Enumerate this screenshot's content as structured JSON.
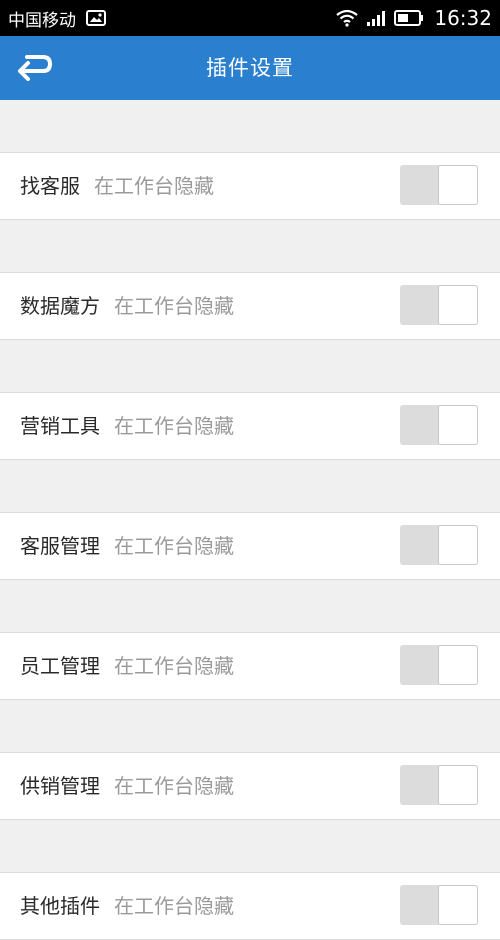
{
  "status_bar": {
    "carrier": "中国移动",
    "time": "16:32",
    "icons": [
      "picture-icon",
      "wifi-icon",
      "signal-icon",
      "battery-icon"
    ]
  },
  "header": {
    "title": "插件设置",
    "back_icon": "back-arrow-icon"
  },
  "colors": {
    "header_bg": "#2a80ce",
    "page_bg": "#f0f0f0",
    "toggle_off": "#dcdcdc"
  },
  "plugins": [
    {
      "name": "找客服",
      "hint": "在工作台隐藏",
      "enabled": false
    },
    {
      "name": "数据魔方",
      "hint": "在工作台隐藏",
      "enabled": false
    },
    {
      "name": "营销工具",
      "hint": "在工作台隐藏",
      "enabled": false
    },
    {
      "name": "客服管理",
      "hint": "在工作台隐藏",
      "enabled": false
    },
    {
      "name": "员工管理",
      "hint": "在工作台隐藏",
      "enabled": false
    },
    {
      "name": "供销管理",
      "hint": "在工作台隐藏",
      "enabled": false
    },
    {
      "name": "其他插件",
      "hint": "在工作台隐藏",
      "enabled": false
    }
  ]
}
